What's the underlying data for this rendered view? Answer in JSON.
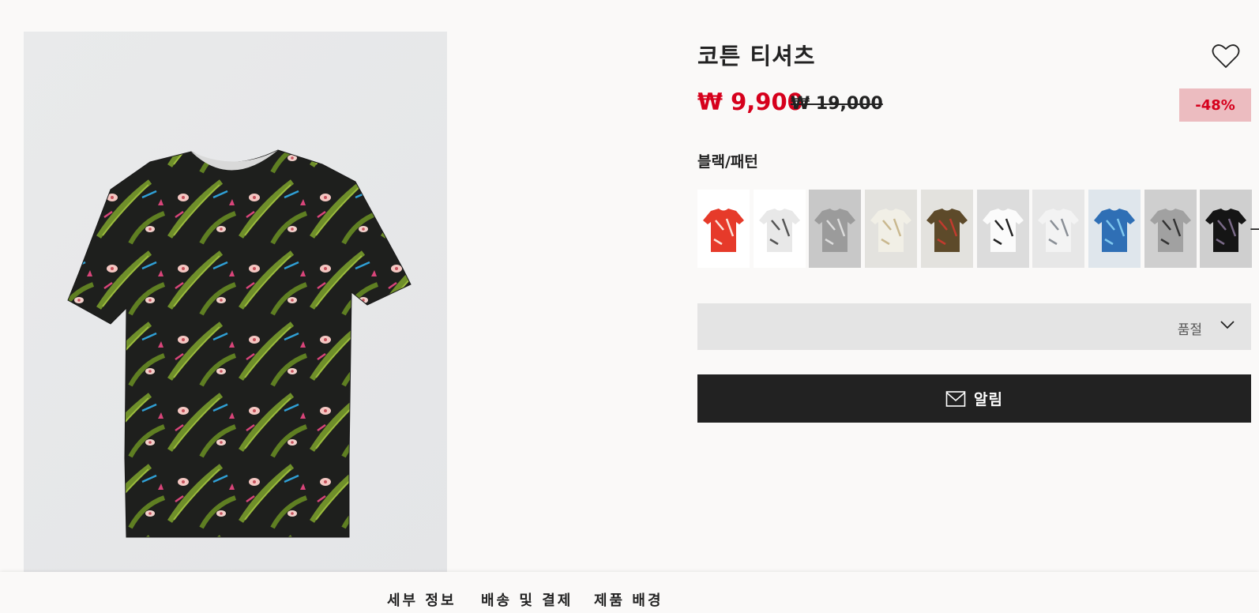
{
  "product": {
    "title": "코튼 티셔츠",
    "price_current": "₩ 9,900",
    "price_original": "₩ 19,000",
    "discount": "-48%",
    "color_name": "블랙/패턴"
  },
  "swatches": [
    {
      "id": "swatch-red",
      "base": "#e63a2a",
      "accent": "#fbe3d9",
      "bg": "#ffffff"
    },
    {
      "id": "swatch-white-leaf",
      "base": "#e8e8e8",
      "accent": "#555555",
      "bg": "#ffffff"
    },
    {
      "id": "swatch-grey-print",
      "base": "#9b9b9b",
      "accent": "#dddddd",
      "bg": "#c8c8c8"
    },
    {
      "id": "swatch-cream",
      "base": "#f1efe6",
      "accent": "#c9b88f",
      "bg": "#e3e2de"
    },
    {
      "id": "swatch-brown-floral",
      "base": "#5d4a2a",
      "accent": "#c23b2e",
      "bg": "#e3e2de"
    },
    {
      "id": "swatch-white-pocket",
      "base": "#fbfbfb",
      "accent": "#222222",
      "bg": "#dcdcdc"
    },
    {
      "id": "swatch-white-palm",
      "base": "#f3f3f3",
      "accent": "#8a8f96",
      "bg": "#e7e7e7"
    },
    {
      "id": "swatch-blue-leaf",
      "base": "#2f6fb5",
      "accent": "#7fc8ef",
      "bg": "#dfe6ec"
    },
    {
      "id": "swatch-grey-pocket",
      "base": "#a1a1a1",
      "accent": "#333333",
      "bg": "#cfcfcf"
    },
    {
      "id": "swatch-black",
      "base": "#151515",
      "accent": "#7a6a88",
      "bg": "#cfcfcf"
    }
  ],
  "size_select": {
    "value": "품절"
  },
  "notify_button": {
    "label": "알림"
  },
  "tabs": [
    {
      "label": "세부 정보"
    },
    {
      "label": "배송 및 결제"
    },
    {
      "label": "제품 배경"
    }
  ],
  "colors": {
    "price_red": "#d6001c",
    "discount_bg": "#ecbcc0",
    "button_dark": "#222222",
    "select_bg": "#e4e4e4"
  },
  "icons": {
    "favorite": "heart-outline-icon",
    "select": "chevron-down-icon",
    "notify": "envelope-icon",
    "carousel_next": "arrow-right-icon"
  }
}
